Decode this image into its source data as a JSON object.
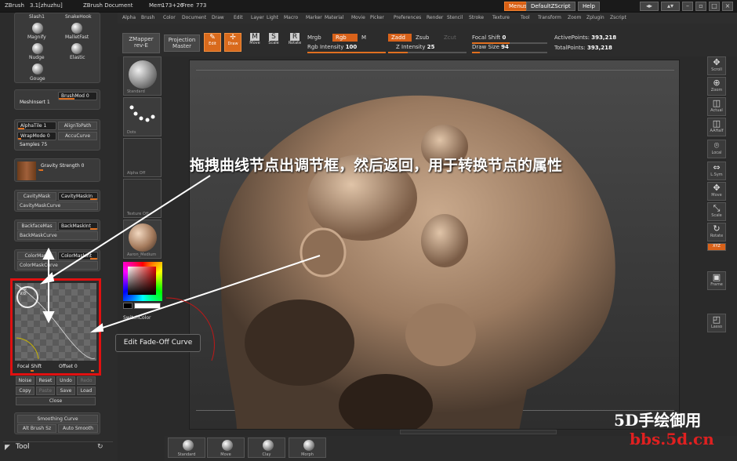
{
  "titlebar": {
    "app": "ZBrush",
    "version": "3.1[zhuzhu]",
    "doc": "ZBrush Document",
    "mem": "Mem",
    "mem_value": "173+26",
    "free": "Free",
    "free_value": "773",
    "menus_label": "Menus",
    "script_label": "DefaultZScript",
    "help_label": "Help"
  },
  "menubar": [
    "Alpha",
    "Brush",
    "Color",
    "Document",
    "Draw",
    "Edit",
    "Layer",
    "Light",
    "Macro",
    "Marker",
    "Material",
    "Movie",
    "Picker",
    "Preferences",
    "Render",
    "Stencil",
    "Stroke",
    "Texture",
    "Tool",
    "Transform",
    "Zoom",
    "Zplugin",
    "Zscript"
  ],
  "brushes": [
    {
      "label": "Slash1"
    },
    {
      "label": "SnakeHook"
    },
    {
      "label": "Magnify"
    },
    {
      "label": "MalletFast"
    },
    {
      "label": "Nudge"
    },
    {
      "label": "Elastic"
    },
    {
      "label": "Gouge"
    }
  ],
  "left": {
    "meshinsert": "MeshInsert 1",
    "brushmod": "BrushMod 0",
    "alphatile": "AlphaTile 1",
    "aligntopath": "AlignToPath",
    "wrapmode": "WrapMode 0",
    "accucurve": "AccuCurve",
    "samples": "Samples 75",
    "gravity": "Gravity Strength 0",
    "cavitymask": "CavityMask",
    "cavitymaskin": "CavityMaskIn",
    "cavitymaskcurve": "CavityMaskCurve",
    "backfacemask": "BackfaceMas",
    "backmaskint": "BackMaskInt",
    "backmaskcurve": "BackMaskCurve",
    "colormask": "ColorMask",
    "colormaskint": "ColorMaskInt",
    "colormaskcurve": "ColorMaskCurve",
    "curve_h": "H:0",
    "curve_v": "V:0",
    "focal_shift": "Focal Shift",
    "offset": "Offset 0",
    "noise": "Noise",
    "reset": "Reset",
    "undo": "Undo",
    "redo": "Redo",
    "copy": "Copy",
    "paste": "Paste",
    "save": "Save",
    "load": "Load",
    "close": "Close",
    "smoothing": "Smoothing Curve",
    "altbrush": "Alt Brush Sz",
    "autosmooth": "Auto Smooth",
    "tool_header": "Tool"
  },
  "toolbar": {
    "zmapper": "ZMapper",
    "zmapper_sub": "rev-E",
    "projection": "Projection",
    "projection_sub": "Master",
    "edit": "Edit",
    "draw": "Draw",
    "move": "Move",
    "scale": "Scale",
    "rotate": "Rotate",
    "mrgb": "Mrgb",
    "rgb": "Rgb",
    "m": "M",
    "zadd": "Zadd",
    "zsub": "Zsub",
    "zcut": "Zcut",
    "focal_shift_label": "Focal Shift",
    "focal_shift_value": "0",
    "active_points_label": "ActivePoints:",
    "active_points_value": "393,218",
    "rgb_intensity_label": "Rgb Intensity",
    "rgb_intensity_value": "100",
    "z_intensity_label": "Z Intensity",
    "z_intensity_value": "25",
    "draw_size_label": "Draw Size",
    "draw_size_value": "94",
    "total_points_label": "TotalPoints:",
    "total_points_value": "393,218"
  },
  "shelf": {
    "thumb1": "Standard",
    "thumb2": "Dots",
    "thumb3": "Alpha Off",
    "thumb4": "Texture Off",
    "thumb5": "Aaron_Medium",
    "switchcolor": "SwitchColor"
  },
  "right": [
    {
      "label": "Scroll",
      "icon": "scroll-icon"
    },
    {
      "label": "Zoom",
      "icon": "zoom-icon"
    },
    {
      "label": "Actual",
      "icon": "actual-icon"
    },
    {
      "label": "AAHalf",
      "icon": "aahalf-icon"
    },
    {
      "label": "Local",
      "icon": "local-icon"
    },
    {
      "label": "L.Sym",
      "icon": "lsym-icon"
    },
    {
      "label": "Move",
      "icon": "move-icon"
    },
    {
      "label": "Scale",
      "icon": "scale-icon"
    },
    {
      "label": "Rotate",
      "icon": "rotate-icon"
    },
    {
      "label": "XYZ",
      "icon": "xyz-icon"
    },
    {
      "label": "Frame",
      "icon": "frame-icon"
    },
    {
      "label": "Lasso",
      "icon": "lasso-icon"
    }
  ],
  "bottom": [
    {
      "label": "Standard"
    },
    {
      "label": "Move"
    },
    {
      "label": "Clay"
    },
    {
      "label": "Morph"
    }
  ],
  "annotation": "拖拽曲线节点出调节框，然后返回，用于转换节点的属性",
  "tooltip": "Edit Fade-Off Curve",
  "watermark1": "5D手绘御用",
  "watermark2": "bbs.5d.cn",
  "colors": {
    "accent": "#d9621a",
    "annotation_box": "#e01010"
  }
}
